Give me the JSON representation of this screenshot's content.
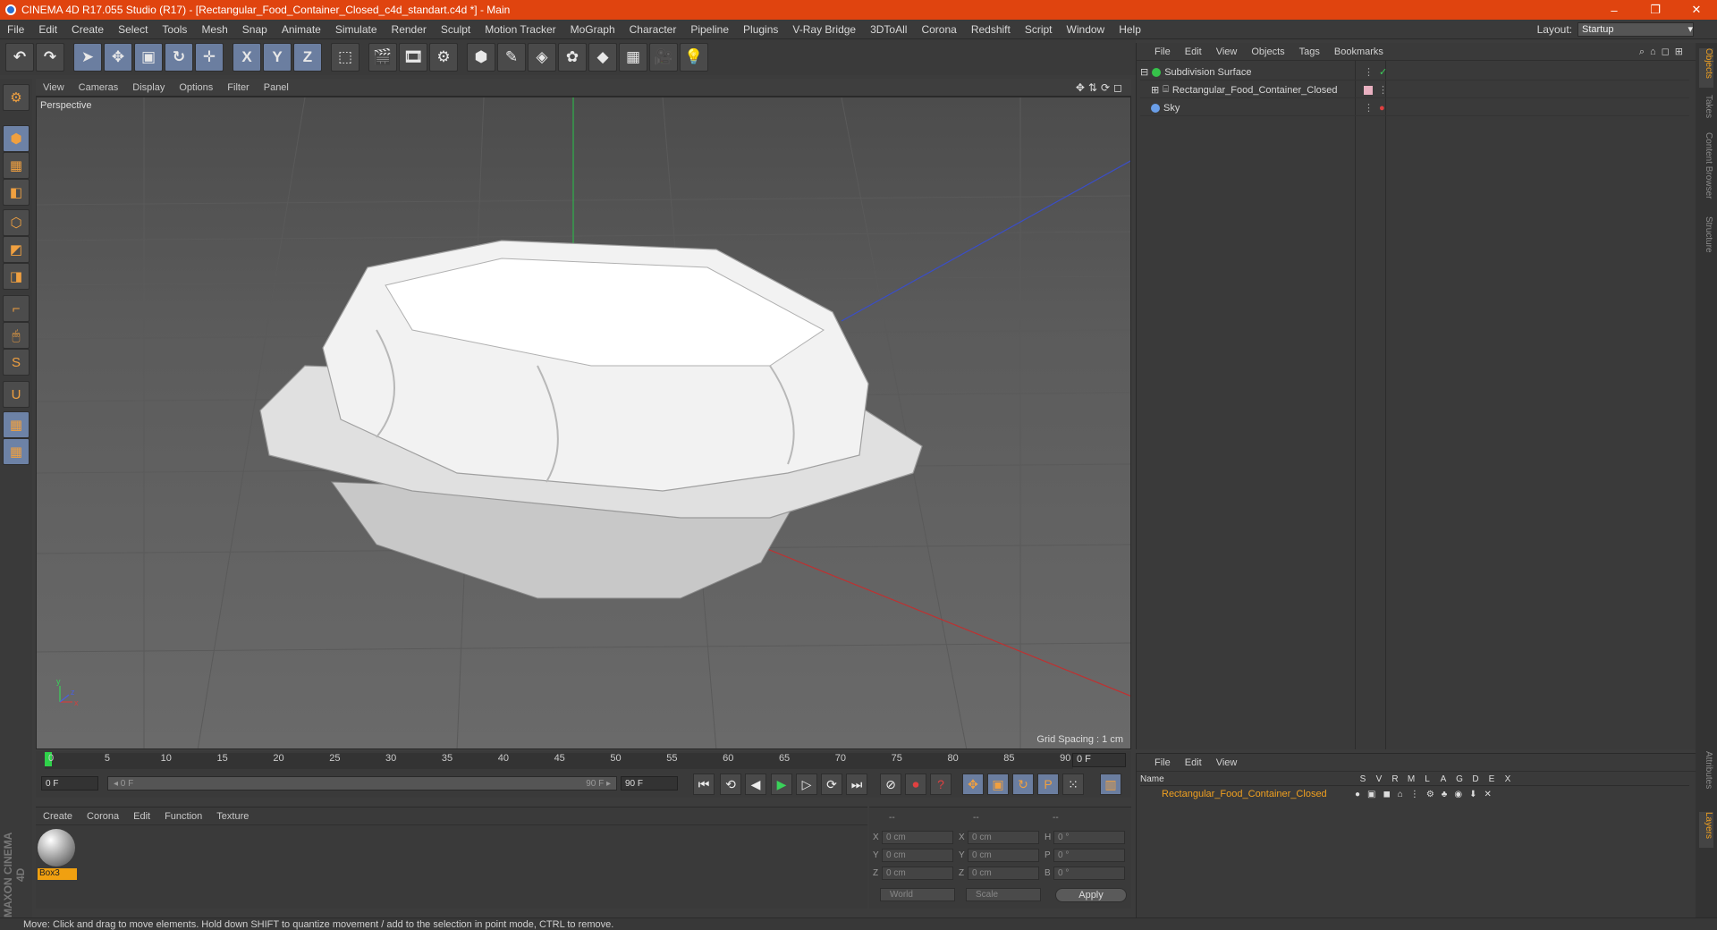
{
  "window": {
    "title": "CINEMA 4D R17.055 Studio (R17) - [Rectangular_Food_Container_Closed_c4d_standart.c4d *] - Main",
    "minimize": "–",
    "maximize": "❐",
    "close": "✕"
  },
  "menubar": {
    "items": [
      "File",
      "Edit",
      "Create",
      "Select",
      "Tools",
      "Mesh",
      "Snap",
      "Animate",
      "Simulate",
      "Render",
      "Sculpt",
      "Motion Tracker",
      "MoGraph",
      "Character",
      "Pipeline",
      "Plugins",
      "V-Ray Bridge",
      "3DToAll",
      "Corona",
      "Redshift",
      "Script",
      "Window",
      "Help"
    ],
    "layout_label": "Layout:",
    "layout_value": "Startup"
  },
  "toolbar": {
    "icons": [
      "undo-icon",
      "redo-icon",
      "select-arrow-icon",
      "move-icon",
      "scale-icon",
      "rotate-icon",
      "live-select-icon",
      "x-axis-icon",
      "y-axis-icon",
      "z-axis-icon",
      "world-coord-icon",
      "render-view-icon",
      "render-picture-viewer-icon",
      "edit-render-settings-icon",
      "cube-icon",
      "pen-icon",
      "subdivision-icon",
      "mograph-cloner-icon",
      "deformer-icon",
      "floor-icon",
      "camera-icon",
      "light-icon"
    ],
    "glyphs": [
      "↶",
      "↷",
      "➤",
      "✥",
      "▣",
      "↻",
      "✛",
      "X",
      "Y",
      "Z",
      "⬚",
      "🎬",
      "🎞",
      "⚙",
      "⬢",
      "✎",
      "◈",
      "✿",
      "◆",
      "▦",
      "🎥",
      "💡"
    ]
  },
  "lefttools": {
    "glyphs": [
      "⚙",
      "⬢",
      "▦",
      "◧",
      "⬡",
      "◩",
      "◨",
      "⌐",
      "🖱",
      "S",
      "U",
      "▦",
      "▦"
    ],
    "names": [
      "make-editable-icon",
      "model-mode-icon",
      "texture-mode-icon",
      "workplane-icon",
      "points-mode-icon",
      "edges-mode-icon",
      "polygons-mode-icon",
      "axis-mode-icon",
      "tweak-mode-icon",
      "snapping-icon",
      "magnet-icon",
      "locked-workplane-icon",
      "planar-workplane-icon"
    ]
  },
  "viewport": {
    "menu": [
      "View",
      "Cameras",
      "Display",
      "Options",
      "Filter",
      "Panel"
    ],
    "nav_icons": "✥⇅⟳◻",
    "camera": "Perspective",
    "grid_spacing": "Grid Spacing : 1 cm",
    "axis_x": "x",
    "axis_y": "y",
    "axis_z": "z"
  },
  "timeline": {
    "ticks": [
      "0",
      "5",
      "10",
      "15",
      "20",
      "25",
      "30",
      "35",
      "40",
      "45",
      "50",
      "55",
      "60",
      "65",
      "70",
      "75",
      "80",
      "85",
      "90"
    ],
    "current_frame": "0 F"
  },
  "transport": {
    "start_field": "0 F",
    "slider_left": "◂ 0 F",
    "slider_right": "90 F ▸",
    "end_field": "90 F",
    "buttons": [
      "⏮",
      "⟲",
      "◀",
      "▶",
      "▷",
      "⟳",
      "⏭",
      "⊘",
      "⏺",
      "?",
      "✥",
      "▣",
      "↻",
      "P",
      "⁙",
      "▥"
    ],
    "button_names": [
      "go-to-start-button",
      "step-back-button",
      "play-backward-button",
      "play-forward-button",
      "step-forward-button",
      "loop-button",
      "go-to-end-button",
      "record-toggle-button",
      "record-active-objects-button",
      "autokey-button",
      "key-position-button",
      "key-scale-button",
      "key-rotation-button",
      "key-parameter-button",
      "key-pla-button",
      "timeline-window-button"
    ]
  },
  "materials": {
    "menu": [
      "Create",
      "Corona",
      "Edit",
      "Function",
      "Texture"
    ],
    "items": [
      {
        "name": "Box3"
      }
    ]
  },
  "coordinates": {
    "headers": [
      "--",
      "--",
      "--"
    ],
    "rows": [
      {
        "l1": "X",
        "v1": "0 cm",
        "l2": "X",
        "v2": "0 cm",
        "l3": "H",
        "v3": "0 °"
      },
      {
        "l1": "Y",
        "v1": "0 cm",
        "l2": "Y",
        "v2": "0 cm",
        "l3": "P",
        "v3": "0 °"
      },
      {
        "l1": "Z",
        "v1": "0 cm",
        "l2": "Z",
        "v2": "0 cm",
        "l3": "B",
        "v3": "0 °"
      }
    ],
    "mode": "World",
    "type": "Scale",
    "apply": "Apply"
  },
  "objects": {
    "menu": [
      "File",
      "Edit",
      "View",
      "Objects",
      "Tags",
      "Bookmarks"
    ],
    "items": [
      {
        "name": "Subdivision Surface",
        "color": "#36c24a"
      },
      {
        "name": "Rectangular_Food_Container_Closed",
        "color": "#d0d0d0"
      },
      {
        "name": "Sky",
        "color": "#6a9ee8"
      }
    ]
  },
  "layers": {
    "menu": [
      "File",
      "Edit",
      "View"
    ],
    "header_name": "Name",
    "columns": [
      "S",
      "V",
      "R",
      "M",
      "L",
      "A",
      "G",
      "D",
      "E",
      "X"
    ],
    "items": [
      {
        "name": "Rectangular_Food_Container_Closed",
        "color": "#f0a020"
      }
    ]
  },
  "sidetabs": [
    "Objects",
    "Takes",
    "Content Browser",
    "Structure",
    "Attributes",
    "Layers"
  ],
  "status": "Move: Click and drag to move elements. Hold down SHIFT to quantize movement / add to the selection in point mode, CTRL to remove.",
  "branding": "MAXON CINEMA 4D"
}
